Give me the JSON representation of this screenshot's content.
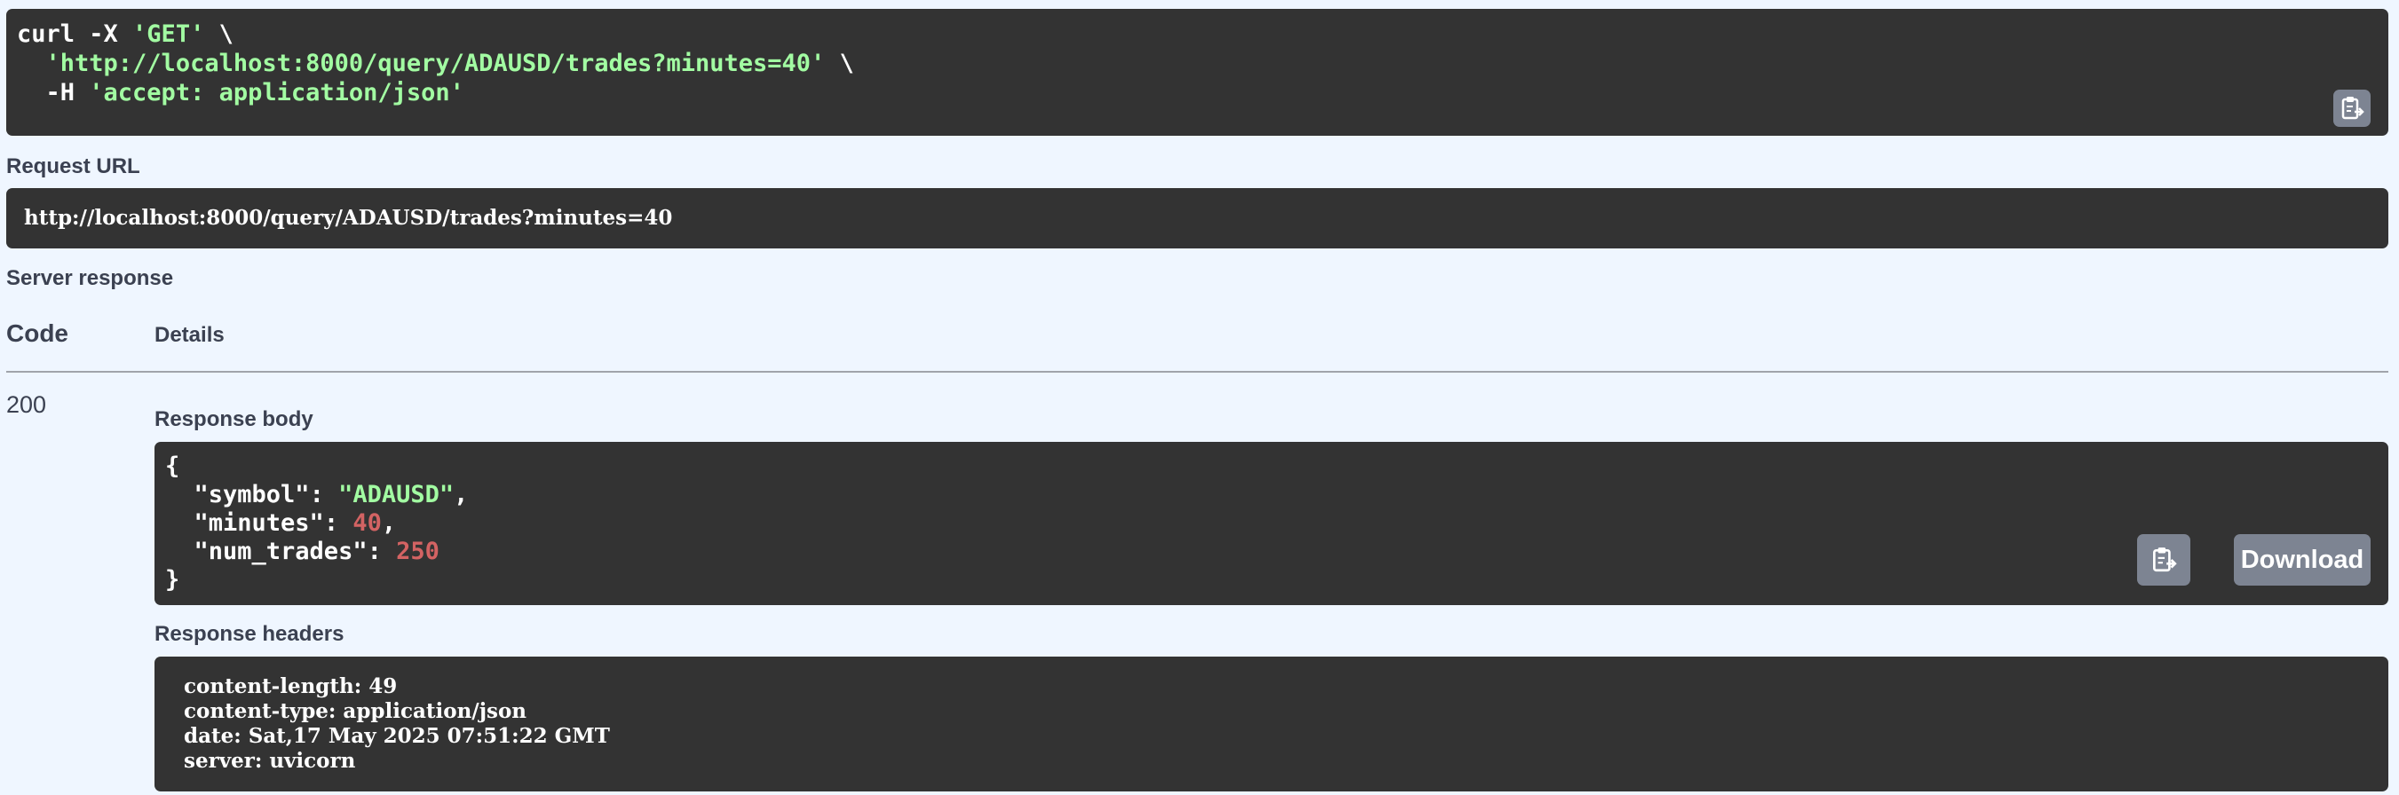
{
  "curl": {
    "line1_prefix": "curl -X ",
    "line1_method": "'GET'",
    "line1_suffix": " \\",
    "line2_indent": "  ",
    "line2_url": "'http://localhost:8000/query/ADAUSD/trades?minutes=40'",
    "line2_suffix": " \\",
    "line3_prefix": "  -H ",
    "line3_header": "'accept: application/json'",
    "copy_icon": "clipboard-copy-icon"
  },
  "request_url": {
    "label": "Request URL",
    "value": "http://localhost:8000/query/ADAUSD/trades?minutes=40"
  },
  "server_response": {
    "label": "Server response",
    "code_header": "Code",
    "details_header": "Details",
    "status_code": "200"
  },
  "response_body": {
    "label": "Response body",
    "open_brace": "{",
    "close_brace": "}",
    "fields": [
      {
        "key": "  \"symbol\"",
        "sep": ": ",
        "value": "\"ADAUSD\"",
        "trail": ","
      },
      {
        "key": "  \"minutes\"",
        "sep": ": ",
        "value": "40",
        "trail": ","
      },
      {
        "key": "  \"num_trades\"",
        "sep": ": ",
        "value": "250",
        "trail": ""
      }
    ],
    "copy_icon": "clipboard-copy-icon",
    "download_label": "Download"
  },
  "response_headers": {
    "label": "Response headers",
    "lines": [
      "content-length: 49",
      "content-type: application/json",
      "date: Sat,17 May 2025 07:51:22 GMT",
      "server: uvicorn"
    ]
  },
  "colors": {
    "background": "#eff6ff",
    "code_bg": "#333333",
    "string": "#a2fca2",
    "number": "#d36363",
    "button": "#7d8492"
  }
}
